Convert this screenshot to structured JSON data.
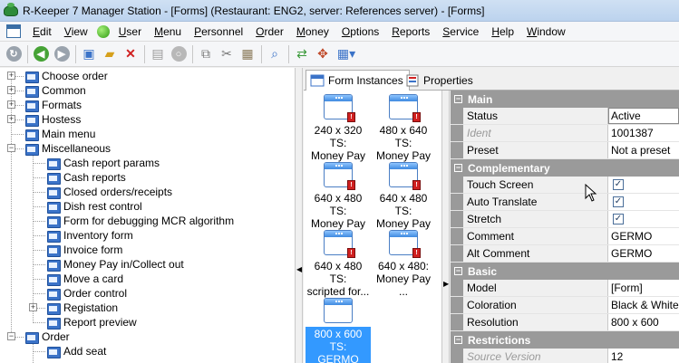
{
  "window": {
    "title": "R-Keeper 7 Manager Station - [Forms] (Restaurant: ENG2, server: References server) - [Forms]"
  },
  "menu": {
    "items": [
      {
        "label": "Edit",
        "key": "E",
        "rest": "dit"
      },
      {
        "label": "View",
        "key": "V",
        "rest": "iew"
      },
      {
        "label": "User",
        "key": "U",
        "rest": "ser"
      },
      {
        "label": "Menu",
        "key": "M",
        "rest": "enu"
      },
      {
        "label": "Personnel",
        "key": "P",
        "rest": "ersonnel"
      },
      {
        "label": "Order",
        "key": "O",
        "rest": "rder"
      },
      {
        "label": "Money",
        "key": "M",
        "rest": "oney"
      },
      {
        "label": "Options",
        "key": "O",
        "rest": "ptions"
      },
      {
        "label": "Reports",
        "key": "R",
        "rest": "eports"
      },
      {
        "label": "Service",
        "key": "S",
        "rest": "ervice"
      },
      {
        "label": "Help",
        "key": "H",
        "rest": "elp"
      },
      {
        "label": "Window",
        "key": "W",
        "rest": "indow"
      }
    ]
  },
  "tree": {
    "items": [
      {
        "label": "Choose order"
      },
      {
        "label": "Common"
      },
      {
        "label": "Formats"
      },
      {
        "label": "Hostess"
      },
      {
        "label": "Main menu"
      },
      {
        "label": "Miscellaneous"
      },
      {
        "label": "Cash report params"
      },
      {
        "label": "Cash reports"
      },
      {
        "label": "Closed orders/receipts"
      },
      {
        "label": "Dish rest control"
      },
      {
        "label": "Form for debugging MCR algorithm"
      },
      {
        "label": "Inventory form"
      },
      {
        "label": "Invoice form"
      },
      {
        "label": "Money Pay in/Collect out"
      },
      {
        "label": "Move a card"
      },
      {
        "label": "Order control"
      },
      {
        "label": "Registation"
      },
      {
        "label": "Report preview"
      },
      {
        "label": "Order"
      },
      {
        "label": "Add seat"
      }
    ]
  },
  "tabs": {
    "form_instances": "Form Instances",
    "properties": "Properties"
  },
  "forms": [
    {
      "line1": "240 x 320 TS:",
      "line2": "Money Pay i..."
    },
    {
      "line1": "480 x 640 TS:",
      "line2": "Money Pay i..."
    },
    {
      "line1": "640 x 480 TS:",
      "line2": "Money Pay i..."
    },
    {
      "line1": "640 x 480 TS:",
      "line2": "Money Pay i..."
    },
    {
      "line1": "640 x 480 TS:",
      "line2": "scripted for..."
    },
    {
      "line1": "640 x 480:",
      "line2": "Money Pay ..."
    },
    {
      "line1": "800 x 600 TS:",
      "line2": "GERMO"
    }
  ],
  "properties": {
    "main": {
      "title": "Main",
      "status": {
        "name": "Status",
        "value": "Active"
      },
      "ident": {
        "name": "Ident",
        "value": "1001387"
      },
      "preset": {
        "name": "Preset",
        "value": "Not a preset"
      }
    },
    "complementary": {
      "title": "Complementary",
      "touch_screen": {
        "name": "Touch Screen",
        "value": "✓"
      },
      "auto_translate": {
        "name": "Auto Translate",
        "value": "✓"
      },
      "stretch": {
        "name": "Stretch",
        "value": "✓"
      },
      "comment": {
        "name": "Comment",
        "value": "GERMO"
      },
      "alt_comment": {
        "name": "Alt Comment",
        "value": "GERMO"
      }
    },
    "basic": {
      "title": "Basic",
      "model": {
        "name": "Model",
        "value": "[Form]"
      },
      "coloration": {
        "name": "Coloration",
        "value": "Black & White"
      },
      "resolution": {
        "name": "Resolution",
        "value": "800 x 600"
      }
    },
    "restrictions": {
      "title": "Restrictions",
      "source_version": {
        "name": "Source Version",
        "value": "12"
      }
    }
  },
  "colors": {
    "category_bg": "#9a9a9a",
    "selection": "#3399ff",
    "folder": "#3b73c8"
  }
}
